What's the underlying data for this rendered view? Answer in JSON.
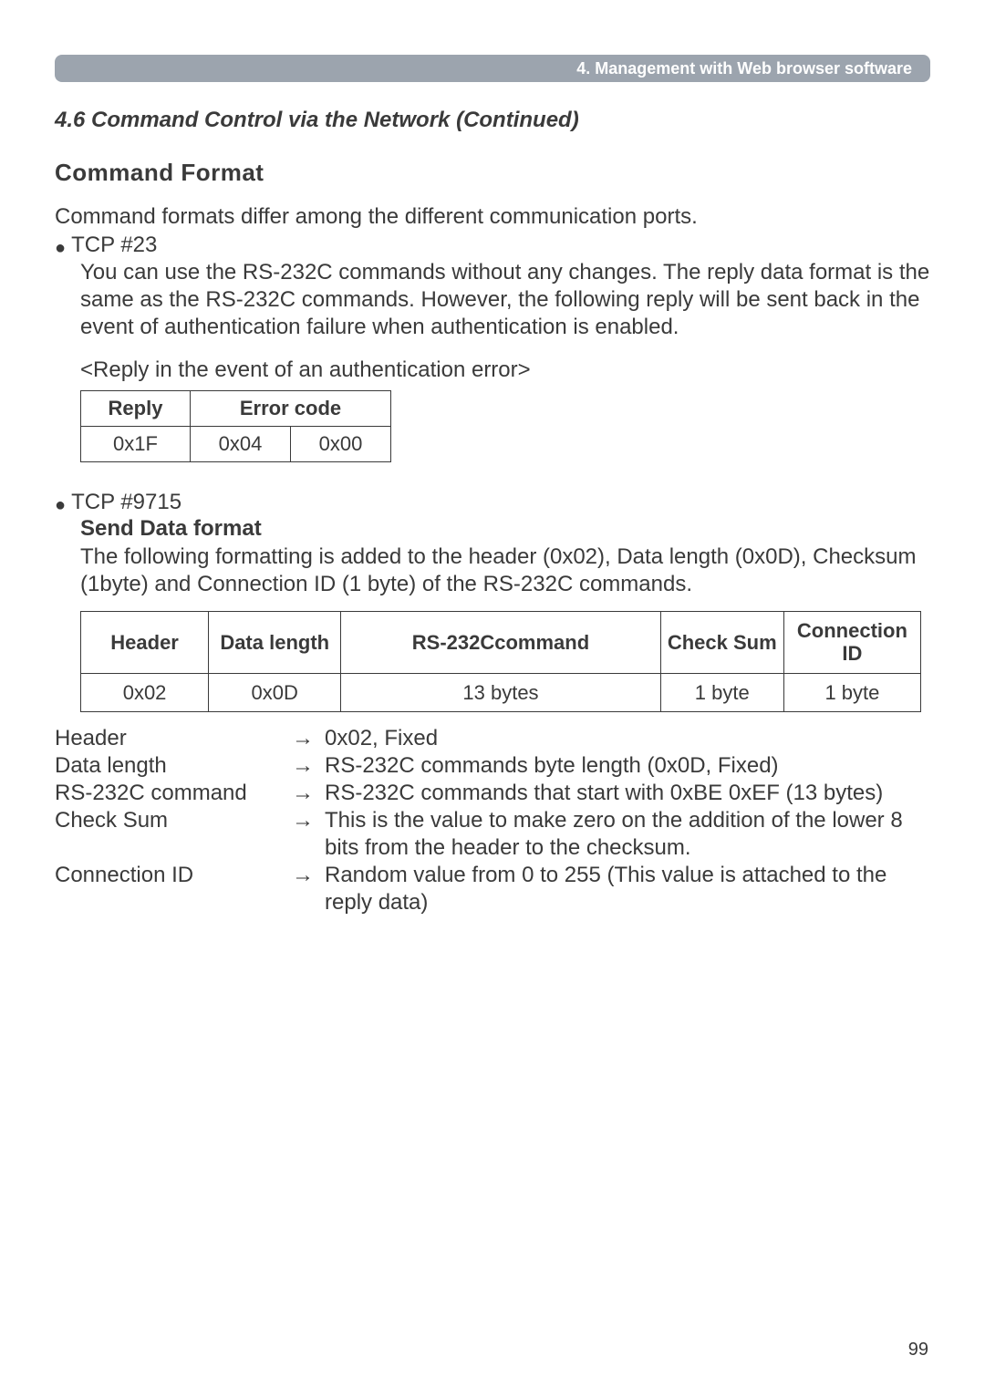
{
  "header_bar": "4. Management with Web browser software",
  "section_title": "4.6 Command Control via the Network (Continued)",
  "cmd_format_title": "Command Format",
  "intro_line": "Command formats differ among the different communication ports.",
  "tcp23": {
    "label": "TCP #23",
    "para": "You can use the RS-232C commands without any changes. The reply data format is the same as the RS-232C commands. However, the following reply will be sent back in the event of authentication failure when authentication is enabled.",
    "reply_caption": "<Reply in the event of an authentication error>",
    "table": {
      "h_reply": "Reply",
      "h_error": "Error code",
      "reply_val": "0x1F",
      "err1": "0x04",
      "err2": "0x00"
    }
  },
  "tcp9715": {
    "label": "TCP #9715",
    "send_title": "Send Data format",
    "para": "The following formatting is added to the header (0x02), Data length (0x0D), Checksum (1byte) and Connection ID (1 byte) of the RS-232C commands.",
    "table": {
      "h_header": "Header",
      "h_datalen": "Data length",
      "h_cmd": "RS-232Ccommand",
      "h_cs": "Check Sum",
      "h_cid": "Connection ID",
      "v_header": "0x02",
      "v_datalen": "0x0D",
      "v_cmd": "13 bytes",
      "v_cs": "1 byte",
      "v_cid": "1 byte"
    },
    "defs": [
      {
        "term": "Header",
        "desc": "0x02, Fixed"
      },
      {
        "term": "Data length",
        "desc": "RS-232C commands byte length (0x0D, Fixed)"
      },
      {
        "term": "RS-232C command",
        "desc": "RS-232C commands that start with 0xBE 0xEF (13 bytes)"
      },
      {
        "term": "Check Sum",
        "desc": "This is the value to make zero on the addition of the lower 8 bits from the header to the checksum."
      },
      {
        "term": "Connection ID",
        "desc": "Random value from 0 to 255 (This value is attached to the reply data)"
      }
    ]
  },
  "arrow": "→",
  "bullet": "●",
  "page_number": "99"
}
